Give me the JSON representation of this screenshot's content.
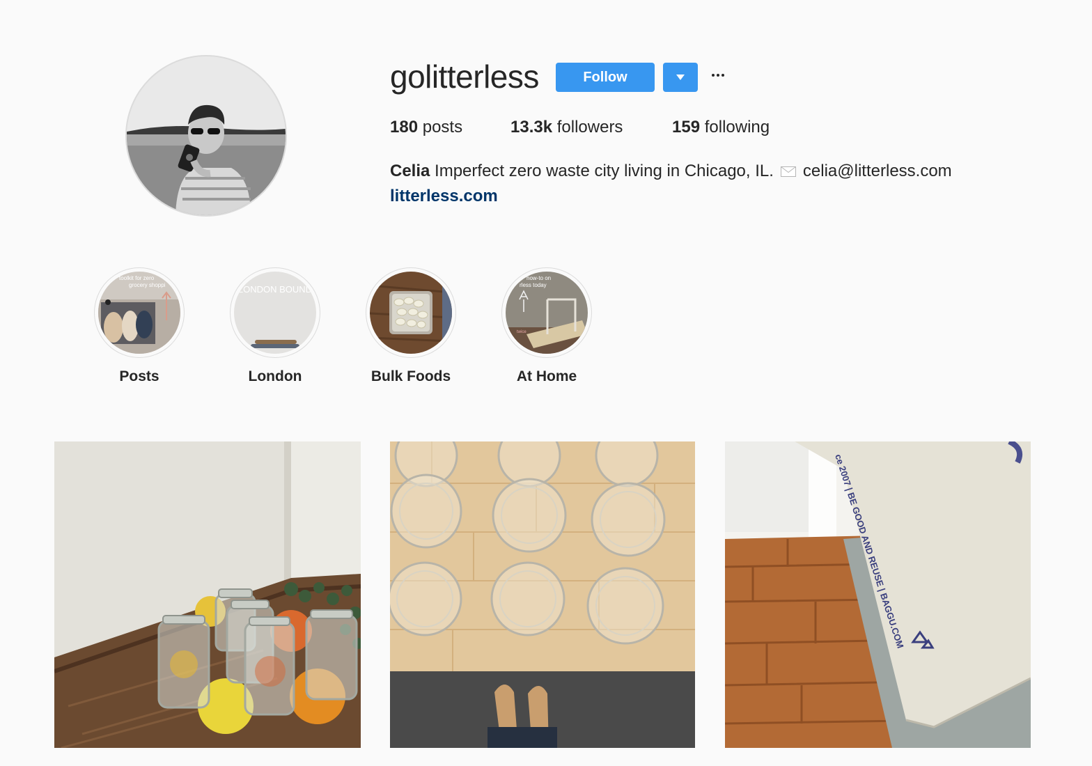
{
  "profile": {
    "username": "golitterless",
    "follow_label": "Follow",
    "dropdown_icon": "chevron-down-icon",
    "more_icon": "ellipsis-icon",
    "avatar_alt": "profile photo",
    "stats": {
      "posts_count": "180",
      "posts_label": "posts",
      "followers_count": "13.3k",
      "followers_label": "followers",
      "following_count": "159",
      "following_label": "following"
    },
    "bio": {
      "name": "Celia",
      "text": "Imperfect zero waste city living in Chicago, IL.",
      "email_icon": "envelope-icon",
      "email": "celia@litterless.com",
      "link": "litterless.com"
    }
  },
  "highlights": [
    {
      "label": "Posts",
      "overlay_line1": "toolkit for zero",
      "overlay_line2": "grocery shoppi"
    },
    {
      "label": "London",
      "overlay_line1": "LONDON BOUND"
    },
    {
      "label": "Bulk Foods"
    },
    {
      "label": "At Home",
      "overlay_line1": "how-to on",
      "overlay_line2": "rless today",
      "overlay_small": "twice"
    }
  ],
  "posts": [
    {
      "name": "mason-jars-citrus"
    },
    {
      "name": "glass-jars-table"
    },
    {
      "name": "baggu-bag-floor",
      "bag_text": "ce 2007 | BE GOOD AND REUSE | BAGGU.COM"
    }
  ],
  "colors": {
    "accent": "#3897f0",
    "link": "#003569",
    "background": "#fafafa",
    "text": "#262626"
  }
}
